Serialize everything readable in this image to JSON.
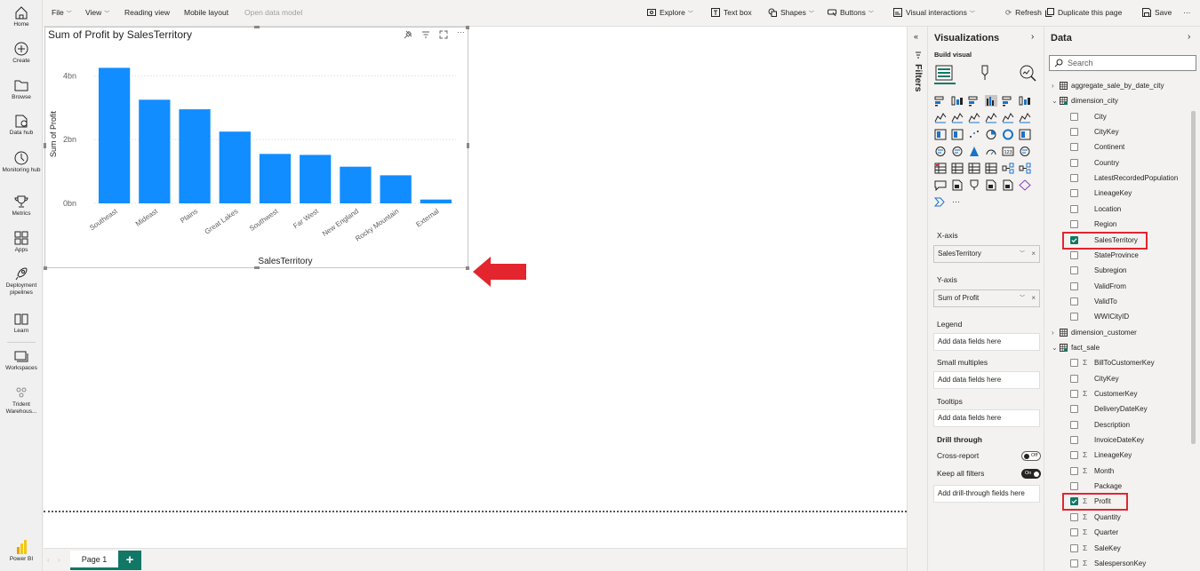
{
  "leftnav": [
    {
      "label": "Home",
      "icon": "home-icon"
    },
    {
      "label": "Create",
      "icon": "create-icon"
    },
    {
      "label": "Browse",
      "icon": "folder-icon"
    },
    {
      "label": "Data hub",
      "icon": "data-hub-icon"
    },
    {
      "label": "Monitoring hub",
      "icon": "monitoring-icon"
    },
    {
      "label": "Metrics",
      "icon": "trophy-icon"
    },
    {
      "label": "Apps",
      "icon": "apps-icon"
    },
    {
      "label": "Deployment pipelines",
      "icon": "rocket-icon"
    },
    {
      "label": "Learn",
      "icon": "book-icon"
    },
    {
      "label": "Workspaces",
      "icon": "workspaces-icon"
    },
    {
      "label": "Trident Warehous...",
      "icon": "warehouse-icon"
    },
    {
      "label": "Power BI",
      "icon": "powerbi-logo"
    }
  ],
  "toolbar": {
    "file": "File",
    "view": "View",
    "reading_view": "Reading view",
    "mobile_layout": "Mobile layout",
    "open_data_model": "Open data model",
    "explore": "Explore",
    "text_box": "Text box",
    "shapes": "Shapes",
    "buttons": "Buttons",
    "visual_interactions": "Visual interactions",
    "refresh": "Refresh",
    "duplicate": "Duplicate this page",
    "save": "Save",
    "more": "···"
  },
  "visual": {
    "title": "Sum of Profit by SalesTerritory"
  },
  "chart_data": {
    "type": "bar",
    "title": "Sum of Profit by SalesTerritory",
    "xlabel": "SalesTerritory",
    "ylabel": "Sum of Profit",
    "categories": [
      "Southeast",
      "Mideast",
      "Plains",
      "Great Lakes",
      "Southwest",
      "Far West",
      "New England",
      "Rocky Mountain",
      "External"
    ],
    "values": [
      4.25,
      3.25,
      2.95,
      2.25,
      1.55,
      1.52,
      1.15,
      0.88,
      0.12
    ],
    "value_unit": "bn",
    "yticks": [
      "0bn",
      "2bn",
      "4bn"
    ],
    "ytick_values": [
      0,
      2,
      4
    ],
    "ylim": [
      0,
      4.4
    ],
    "grid": true,
    "bar_color": "#118dff"
  },
  "pages": {
    "tab1": "Page 1",
    "add": "+"
  },
  "filters": {
    "label": "Filters"
  },
  "viz": {
    "title": "Visualizations",
    "build_visual": "Build visual",
    "xaxis_label": "X-axis",
    "xaxis_value": "SalesTerritory",
    "yaxis_label": "Y-axis",
    "yaxis_value": "Sum of Profit",
    "legend_label": "Legend",
    "legend_placeholder": "Add data fields here",
    "small_multiples_label": "Small multiples",
    "small_multiples_placeholder": "Add data fields here",
    "tooltips_label": "Tooltips",
    "tooltips_placeholder": "Add data fields here",
    "drill_through": "Drill through",
    "cross_report": "Cross-report",
    "cross_report_toggle": "Off",
    "keep_all_filters": "Keep all filters",
    "keep_all_filters_toggle": "On",
    "drill_placeholder": "Add drill-through fields here",
    "more": "···"
  },
  "data": {
    "title": "Data",
    "search_placeholder": "Search",
    "tables": [
      {
        "name": "aggregate_sale_by_date_city",
        "expanded": false
      },
      {
        "name": "dimension_city",
        "expanded": true
      },
      {
        "name": "dimension_customer",
        "expanded": false
      },
      {
        "name": "fact_sale",
        "expanded": true
      }
    ],
    "city_fields": [
      "City",
      "CityKey",
      "Continent",
      "Country",
      "LatestRecordedPopulation",
      "LineageKey",
      "Location",
      "Region",
      "SalesTerritory",
      "StateProvince",
      "Subregion",
      "ValidFrom",
      "ValidTo",
      "WWICityID"
    ],
    "sale_fields": [
      {
        "name": "BillToCustomerKey",
        "sigma": true
      },
      {
        "name": "CityKey",
        "sigma": false
      },
      {
        "name": "CustomerKey",
        "sigma": true
      },
      {
        "name": "DeliveryDateKey",
        "sigma": false
      },
      {
        "name": "Description",
        "sigma": false
      },
      {
        "name": "InvoiceDateKey",
        "sigma": false
      },
      {
        "name": "LineageKey",
        "sigma": true
      },
      {
        "name": "Month",
        "sigma": true
      },
      {
        "name": "Package",
        "sigma": false
      },
      {
        "name": "Profit",
        "sigma": true
      },
      {
        "name": "Quantity",
        "sigma": true
      },
      {
        "name": "Quarter",
        "sigma": true
      },
      {
        "name": "SaleKey",
        "sigma": true
      },
      {
        "name": "SalespersonKey",
        "sigma": true
      }
    ],
    "checked": [
      "SalesTerritory",
      "Profit"
    ]
  },
  "colors": {
    "accent": "#117865",
    "bar": "#118dff",
    "highlight": "#e3252e"
  }
}
